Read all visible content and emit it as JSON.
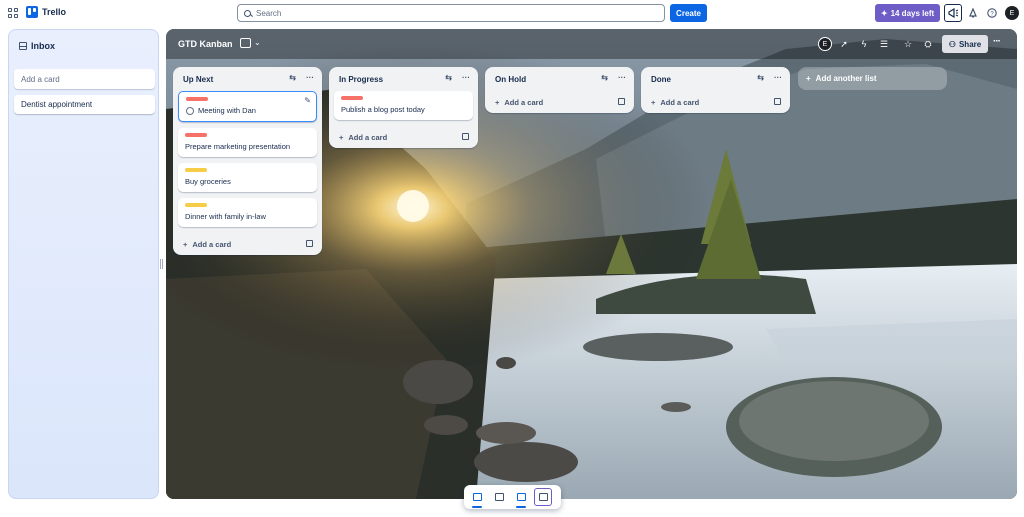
{
  "topbar": {
    "app_name": "Trello",
    "search_placeholder": "Search",
    "create_label": "Create",
    "trial_label": "14 days left",
    "avatar_initial": "E"
  },
  "inbox": {
    "title": "Inbox",
    "add_placeholder": "Add a card",
    "cards": [
      "Dentist appointment"
    ]
  },
  "board": {
    "name": "GTD Kanban",
    "member_initial": "E",
    "share_label": "Share",
    "add_list_label": "Add another list",
    "lists": [
      {
        "title": "Up Next",
        "cards": [
          {
            "label_color": "#f87168",
            "text": "Meeting with Dan"
          },
          {
            "label_color": "#f87168",
            "text": "Prepare marketing presentation"
          },
          {
            "label_color": "#f5cd47",
            "text": "Buy groceries"
          },
          {
            "label_color": "#f5cd47",
            "text": "Dinner with family in-law"
          }
        ],
        "add_label": "Add a card"
      },
      {
        "title": "In Progress",
        "cards": [
          {
            "label_color": "#f87168",
            "text": "Publish a blog post today"
          }
        ],
        "add_label": "Add a card"
      },
      {
        "title": "On Hold",
        "cards": [],
        "add_label": "Add a card"
      },
      {
        "title": "Done",
        "cards": [],
        "add_label": "Add a card"
      }
    ]
  },
  "icons": {
    "apps": "grid-icon",
    "board_view": "board-view-icon",
    "power_ups": "rocket-icon",
    "automation": "lightning-icon",
    "filter": "filter-icon",
    "star": "star-icon",
    "visibility": "users-icon",
    "notifications": "megaphone-icon"
  }
}
